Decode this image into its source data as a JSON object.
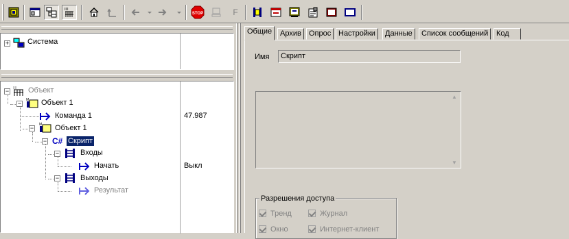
{
  "toolbar": {
    "buttons": [
      "object-icon",
      "window-icon",
      "tree-view-icon",
      "object-tag-icon",
      "home-icon",
      "up-level-icon",
      "back-arrow-icon",
      "forward-arrow-icon",
      "stop-icon",
      "computer-icon",
      "function-icon",
      "object-tool-icon",
      "form-icon",
      "screen-icon",
      "properties-icon",
      "book-icon",
      "rectangle-icon"
    ],
    "stop_label": "STOP",
    "f_label": "F"
  },
  "system_tree": {
    "root_label": "Система"
  },
  "object_tree": {
    "root_label": "Объект",
    "nodes": [
      {
        "label": "Объект 1",
        "value": ""
      },
      {
        "label": "Команда 1",
        "value": "47.987"
      },
      {
        "label": "Объект 1",
        "value": ""
      },
      {
        "label": "Скрипт",
        "value": ""
      },
      {
        "label": "Входы",
        "value": ""
      },
      {
        "label": "Начать",
        "value": "Выкл"
      },
      {
        "label": "Выходы",
        "value": ""
      },
      {
        "label": "Результат",
        "value": ""
      }
    ],
    "icon_tags": {
      "obj_tag": "M",
      "obj_tag2": "H",
      "script_tag": "C#",
      "root_tag": "IIII"
    }
  },
  "tabs": [
    "Общие",
    "Архив",
    "Опрос",
    "Настройки",
    "Данные",
    "Список сообщений",
    "Код"
  ],
  "general": {
    "name_label": "Имя",
    "name_value": "Скрипт",
    "description_value": "",
    "access_group_title": "Разрешения доступа",
    "access": [
      {
        "label": "Тренд",
        "checked": true
      },
      {
        "label": "Журнал",
        "checked": true
      },
      {
        "label": "Окно",
        "checked": true
      },
      {
        "label": "Интернет-клиент",
        "checked": true
      }
    ]
  },
  "colors": {
    "face": "#d4d0c8",
    "selection": "#0a246a",
    "disabled_text": "#808080"
  }
}
